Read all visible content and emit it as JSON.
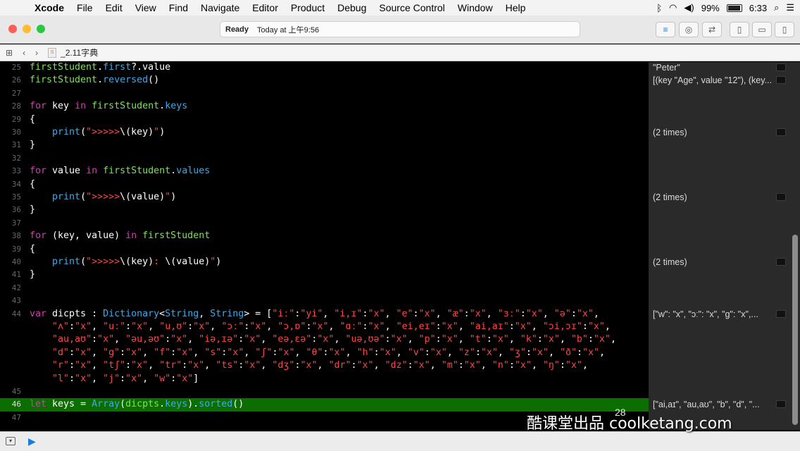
{
  "menubar": {
    "apple": "",
    "items": [
      "Xcode",
      "File",
      "Edit",
      "View",
      "Find",
      "Navigate",
      "Editor",
      "Product",
      "Debug",
      "Source Control",
      "Window",
      "Help"
    ],
    "battery": "99%",
    "clock": "6:33"
  },
  "toolbar": {
    "status": "Ready",
    "time": "Today at 上午9:56"
  },
  "jumpbar": {
    "file": "_2.11字典"
  },
  "editor": {
    "lines": [
      {
        "n": "25",
        "html": "<span class=\"id\">firstStudent</span>.<span class=\"prop\">first</span>?.value"
      },
      {
        "n": "26",
        "html": "<span class=\"id\">firstStudent</span>.<span class=\"fn\">reversed</span>()"
      },
      {
        "n": "27",
        "html": ""
      },
      {
        "n": "28",
        "html": "<span class=\"kw\">for</span> key <span class=\"kw\">in</span> <span class=\"id\">firstStudent</span>.<span class=\"prop\">keys</span>"
      },
      {
        "n": "29",
        "html": "{"
      },
      {
        "n": "30",
        "html": "    <span class=\"fn\">print</span>(<span class=\"str\">\"&gt;&gt;&gt;&gt;&gt;</span>\\(key)<span class=\"str\">\"</span>)"
      },
      {
        "n": "31",
        "html": "}"
      },
      {
        "n": "32",
        "html": ""
      },
      {
        "n": "33",
        "html": "<span class=\"kw\">for</span> value <span class=\"kw\">in</span> <span class=\"id\">firstStudent</span>.<span class=\"prop\">values</span>"
      },
      {
        "n": "34",
        "html": "{"
      },
      {
        "n": "35",
        "html": "    <span class=\"fn\">print</span>(<span class=\"str\">\"&gt;&gt;&gt;&gt;&gt;</span>\\(value)<span class=\"str\">\"</span>)"
      },
      {
        "n": "36",
        "html": "}"
      },
      {
        "n": "37",
        "html": ""
      },
      {
        "n": "38",
        "html": "<span class=\"kw\">for</span> (key, value) <span class=\"kw\">in</span> <span class=\"id\">firstStudent</span>"
      },
      {
        "n": "39",
        "html": "{"
      },
      {
        "n": "40",
        "html": "    <span class=\"fn\">print</span>(<span class=\"str\">\"&gt;&gt;&gt;&gt;&gt;</span>\\(key)<span class=\"str\">: </span>\\(value)<span class=\"str\">\"</span>)"
      },
      {
        "n": "41",
        "html": "}"
      },
      {
        "n": "42",
        "html": ""
      },
      {
        "n": "43",
        "html": ""
      },
      {
        "n": "44",
        "html": "<span class=\"kw\">var</span> dicpts : <span class=\"ty\">Dictionary</span>&lt;<span class=\"ty\">String</span>, <span class=\"ty\">String</span>&gt; = [<span class=\"str\">\"iː\"</span>:<span class=\"str\">\"yi\"</span>, <span class=\"str\">\"i,ɪ\"</span>:<span class=\"str\">\"x\"</span>, <span class=\"str\">\"e\"</span>:<span class=\"str\">\"x\"</span>, <span class=\"str\">\"æ\"</span>:<span class=\"str\">\"x\"</span>, <span class=\"str\">\"ɜː\"</span>:<span class=\"str\">\"x\"</span>, <span class=\"str\">\"ə\"</span>:<span class=\"str\">\"x\"</span>,"
      },
      {
        "n": "",
        "html": "    <span class=\"str\">\"ʌ\"</span>:<span class=\"str\">\"x\"</span>, <span class=\"str\">\"uː\"</span>:<span class=\"str\">\"x\"</span>, <span class=\"str\">\"u,ʊ\"</span>:<span class=\"str\">\"x\"</span>, <span class=\"str\">\"ɔː\"</span>:<span class=\"str\">\"x\"</span>, <span class=\"str\">\"ɔ,ɒ\"</span>:<span class=\"str\">\"x\"</span>, <span class=\"str\">\"ɑː\"</span>:<span class=\"str\">\"x\"</span>, <span class=\"str\">\"ei,eɪ\"</span>:<span class=\"str\">\"x\"</span>, <span class=\"str\">\"ai,aɪ\"</span>:<span class=\"str\">\"x\"</span>, <span class=\"str\">\"ɔi,ɔɪ\"</span>:<span class=\"str\">\"x\"</span>,"
      },
      {
        "n": "",
        "html": "    <span class=\"str\">\"au,aʊ\"</span>:<span class=\"str\">\"x\"</span>, <span class=\"str\">\"əu,əʊ\"</span>:<span class=\"str\">\"x\"</span>, <span class=\"str\">\"iə,ɪə\"</span>:<span class=\"str\">\"x\"</span>, <span class=\"str\">\"eə,ɛə\"</span>:<span class=\"str\">\"x\"</span>, <span class=\"str\">\"uə,ʊə\"</span>:<span class=\"str\">\"x\"</span>, <span class=\"str\">\"p\"</span>:<span class=\"str\">\"x\"</span>, <span class=\"str\">\"t\"</span>:<span class=\"str\">\"x\"</span>, <span class=\"str\">\"k\"</span>:<span class=\"str\">\"x\"</span>, <span class=\"str\">\"b\"</span>:<span class=\"str\">\"x\"</span>,"
      },
      {
        "n": "",
        "html": "    <span class=\"str\">\"d\"</span>:<span class=\"str\">\"x\"</span>, <span class=\"str\">\"g\"</span>:<span class=\"str\">\"x\"</span>, <span class=\"str\">\"f\"</span>:<span class=\"str\">\"x\"</span>, <span class=\"str\">\"s\"</span>:<span class=\"str\">\"x\"</span>, <span class=\"str\">\"ʃ\"</span>:<span class=\"str\">\"x\"</span>, <span class=\"str\">\"θ\"</span>:<span class=\"str\">\"x\"</span>, <span class=\"str\">\"h\"</span>:<span class=\"str\">\"x\"</span>, <span class=\"str\">\"v\"</span>:<span class=\"str\">\"x\"</span>, <span class=\"str\">\"z\"</span>:<span class=\"str\">\"x\"</span>, <span class=\"str\">\"ʒ\"</span>:<span class=\"str\">\"x\"</span>, <span class=\"str\">\"ð\"</span>:<span class=\"str\">\"x\"</span>,"
      },
      {
        "n": "",
        "html": "    <span class=\"str\">\"r\"</span>:<span class=\"str\">\"x\"</span>, <span class=\"str\">\"tʃ\"</span>:<span class=\"str\">\"x\"</span>, <span class=\"str\">\"tr\"</span>:<span class=\"str\">\"x\"</span>, <span class=\"str\">\"ts\"</span>:<span class=\"str\">\"x\"</span>, <span class=\"str\">\"dʒ\"</span>:<span class=\"str\">\"x\"</span>, <span class=\"str\">\"dr\"</span>:<span class=\"str\">\"x\"</span>, <span class=\"str\">\"dz\"</span>:<span class=\"str\">\"x\"</span>, <span class=\"str\">\"m\"</span>:<span class=\"str\">\"x\"</span>, <span class=\"str\">\"n\"</span>:<span class=\"str\">\"x\"</span>, <span class=\"str\">\"ŋ\"</span>:<span class=\"str\">\"x\"</span>,"
      },
      {
        "n": "",
        "html": "    <span class=\"str\">\"l\"</span>:<span class=\"str\">\"x\"</span>, <span class=\"str\">\"j\"</span>:<span class=\"str\">\"x\"</span>, <span class=\"str\">\"w\"</span>:<span class=\"str\">\"x\"</span>]"
      },
      {
        "n": "45",
        "html": ""
      },
      {
        "n": "46",
        "html": "<span class=\"kw\">let</span> keys = <span class=\"ty\">Array</span>(<span class=\"id\">dicpts</span>.<span class=\"prop\">keys</span>).<span class=\"fn\">sorted</span>()",
        "current": true
      },
      {
        "n": "47",
        "html": ""
      }
    ]
  },
  "results": [
    {
      "line": 0,
      "text": "\"Peter\""
    },
    {
      "line": 1,
      "text": "[(key \"Age\", value \"12\"), (key..."
    },
    {
      "line": 5,
      "text": "(2 times)"
    },
    {
      "line": 10,
      "text": "(2 times)"
    },
    {
      "line": 15,
      "text": "(2 times)"
    },
    {
      "line": 19,
      "text": "[\"w\": \"x\", \"ɔː\": \"x\", \"g\": \"x\",..."
    },
    {
      "line": 26,
      "text": "[\"ai,aɪ\", \"au,aʊ\", \"b\", \"d\", \"..."
    }
  ],
  "watermark": "酷课堂出品 coolketang.com",
  "counter": "28"
}
